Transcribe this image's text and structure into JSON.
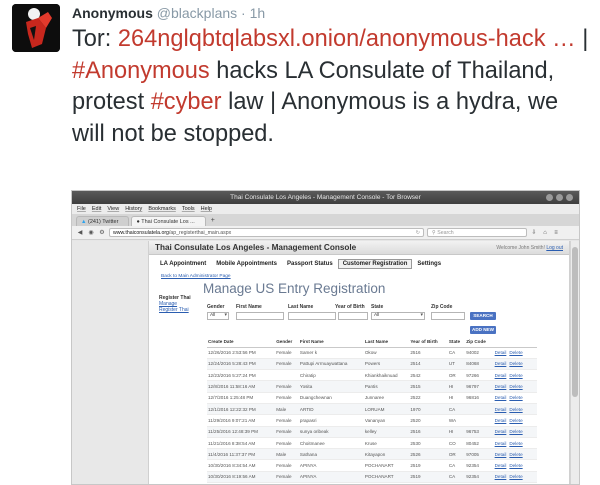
{
  "tweet": {
    "author_name": "Anonymous",
    "handle": "@blackplans",
    "separator": " · ",
    "time": "1h",
    "lead": "Tor: ",
    "link": "264nglqbtqlabsxl.onion/anonymous-hack",
    "ellipsis": "  …",
    "pipe1": " | ",
    "hashtag1": "#Anonymous",
    "mid_text": " hacks LA Consulate of Thailand, protest ",
    "hashtag2": "#cyber",
    "tail_text": " law | Anonymous is a hydra, we will not be stopped.",
    "colors": {
      "hashtag": "#c23a2e",
      "meta": "#8899a6",
      "text": "#292f33"
    }
  },
  "browser": {
    "window_title": "Thai Consulate Los Angeles - Management Console - Tor Browser",
    "menu": [
      "File",
      "Edit",
      "View",
      "History",
      "Bookmarks",
      "Tools",
      "Help"
    ],
    "tabs": [
      {
        "label": "(241) Twitter"
      },
      {
        "label": "Thai Consulate Los ..."
      }
    ],
    "new_tab": "+",
    "url_host": "www.thaiconsulatela.org",
    "url_path": "/ap_registerthai_main.aspx",
    "search_placeholder": "Search"
  },
  "page": {
    "title": "Thai Consulate Los Angeles - Management Console",
    "welcome_text": "Welcome John Smith!",
    "logout": "Log out",
    "nav_tabs": [
      "LA Appointment",
      "Mobile Appointments",
      "Passport Status",
      "Customer Registration",
      "Settings"
    ],
    "back_link": "Back to Main Administrator Page",
    "side_title": "Register Thai",
    "side_links": [
      "Manage",
      "Register Thai"
    ],
    "heading": "Manage US Entry Registration",
    "filters": {
      "labels": [
        "Gender",
        "First Name",
        "Last Name",
        "Year of Birth",
        "State",
        "Zip Code"
      ],
      "gender_value": "All",
      "state_value": "All",
      "search_button": "SEARCH"
    },
    "add_button": "ADD NEW",
    "columns": [
      "Create Date",
      "Gender",
      "First Name",
      "Last Name",
      "Year of Birth",
      "State",
      "Zip Code",
      ""
    ],
    "rows": [
      [
        "12/26/2016 2:53:56 PM",
        "Female",
        "Samer k",
        "Okow",
        "2516",
        "CA",
        "94002",
        "Detail",
        "Delete"
      ],
      [
        "12/24/2016 5:28:43 PM",
        "Female",
        "Pattupi Arrnuaywattana",
        "Powers",
        "2514",
        "UT",
        "84068",
        "Detail",
        "Delete"
      ],
      [
        "12/23/2016 5:27:24 PM",
        "",
        "Chiratip",
        "Khiankhaiknuad",
        "2542",
        "OR",
        "97266",
        "Detail",
        "Delete"
      ],
      [
        "12/8/2016 11:58:16 AM",
        "Female",
        "Yosita",
        "Pantis",
        "2515",
        "HI",
        "96797",
        "Detail",
        "Delete"
      ],
      [
        "12/7/2016 1:25:48 PM",
        "Female",
        "Duangchewnan",
        "Junnaree",
        "2522",
        "HI",
        "96816",
        "Detail",
        "Delete"
      ],
      [
        "12/1/2016 12:22:32 PM",
        "Male",
        "ARTID",
        "LORUAM",
        "1970",
        "CA",
        "",
        "Detail",
        "Delete"
      ],
      [
        "11/29/2016 9:07:21 AM",
        "Female",
        "prapasri",
        "Vananyan",
        "2520",
        "WA",
        "",
        "Detail",
        "Delete"
      ],
      [
        "11/25/2016 12:48:39 PM",
        "Female",
        "sunya oribeak",
        "kelley",
        "2516",
        "HI",
        "96753",
        "Detail",
        "Delete"
      ],
      [
        "11/21/2016 8:38:54 AM",
        "Female",
        "Choitmanee",
        "Kruse",
        "2530",
        "CO",
        "80452",
        "Detail",
        "Delete"
      ],
      [
        "11/4/2016 11:37:37 PM",
        "Male",
        "Sathana",
        "Kitayapon",
        "2526",
        "OR",
        "97005",
        "Detail",
        "Delete"
      ],
      [
        "10/30/2016 8:34:54 AM",
        "Female",
        "APINYA",
        "POCHANART",
        "2519",
        "CA",
        "92354",
        "Detail",
        "Delete"
      ],
      [
        "10/30/2016 8:19:56 AM",
        "Female",
        "APINYA",
        "POCHANART",
        "2519",
        "CA",
        "92354",
        "Detail",
        "Delete"
      ]
    ]
  }
}
